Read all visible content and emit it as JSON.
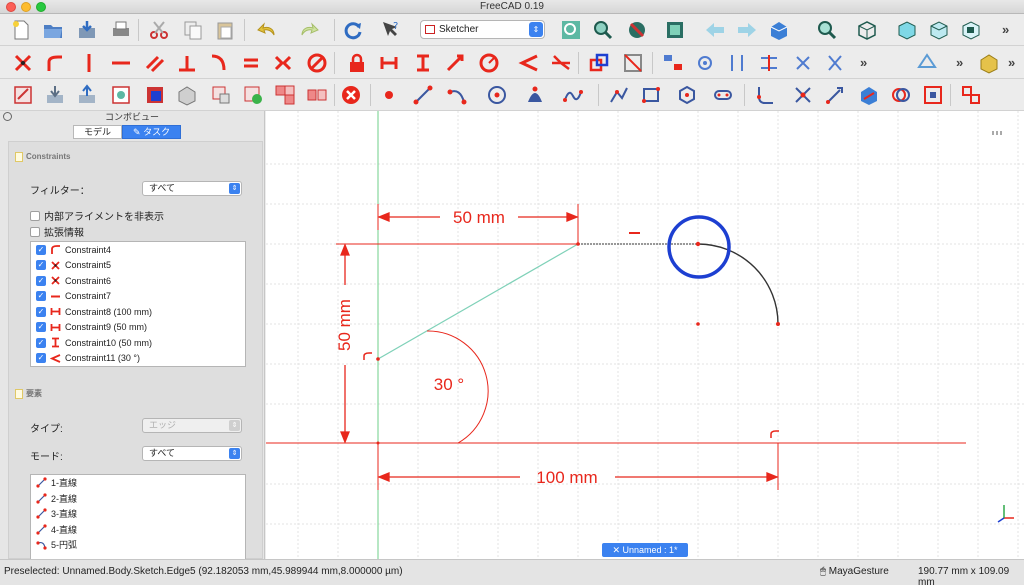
{
  "window": {
    "title": "FreeCAD 0.19"
  },
  "toolbar": {
    "workbench": "Sketcher"
  },
  "combo": {
    "title": "コンボビュー",
    "tabs": [
      {
        "label": "モデル"
      },
      {
        "label": "タスク"
      }
    ],
    "constraints_section": "Constraints",
    "filter_label": "フィルター：",
    "filter_value": "すべて",
    "hide_internal_label": "内部アライメントを非表示",
    "extended_info_label": "拡張情報",
    "constraints": [
      {
        "label": "Constraint4",
        "icon": "tangent-icon",
        "checked": true
      },
      {
        "label": "Constraint5",
        "icon": "coincident-icon",
        "checked": true
      },
      {
        "label": "Constraint6",
        "icon": "coincident-icon",
        "checked": true
      },
      {
        "label": "Constraint7",
        "icon": "horizontal-icon",
        "checked": true
      },
      {
        "label": "Constraint8 (100 mm)",
        "icon": "horizontal-distance-icon",
        "checked": true
      },
      {
        "label": "Constraint9 (50 mm)",
        "icon": "horizontal-distance-icon",
        "checked": true
      },
      {
        "label": "Constraint10 (50 mm)",
        "icon": "vertical-distance-icon",
        "checked": true
      },
      {
        "label": "Constraint11 (30 °)",
        "icon": "angle-icon",
        "checked": true
      }
    ],
    "elements_section": "要素",
    "type_label": "タイプ:",
    "type_value": "エッジ",
    "mode_label": "モード:",
    "mode_value": "すべて",
    "elements": [
      {
        "label": "1-直線",
        "icon": "line-icon"
      },
      {
        "label": "2-直線",
        "icon": "line-icon"
      },
      {
        "label": "3-直線",
        "icon": "line-icon"
      },
      {
        "label": "4-直線",
        "icon": "line-icon"
      },
      {
        "label": "5-円弧",
        "icon": "arc-icon"
      }
    ]
  },
  "canvas": {
    "dim_top": "50 mm",
    "dim_left": "50 mm",
    "dim_angle": "30 °",
    "dim_bottom": "100 mm",
    "view_tab": "Unnamed : 1*",
    "colors": {
      "constraint": "#e8271c",
      "geometry": "#7fd1b8",
      "selection": "#1d3fd1"
    }
  },
  "status": {
    "message": "Preselected: Unnamed.Body.Sketch.Edge5 (92.182053 mm,45.989944 mm,8.000000 µm)",
    "nav_style": "MayaGesture",
    "dimensions": "190.77 mm x 109.09 mm"
  }
}
